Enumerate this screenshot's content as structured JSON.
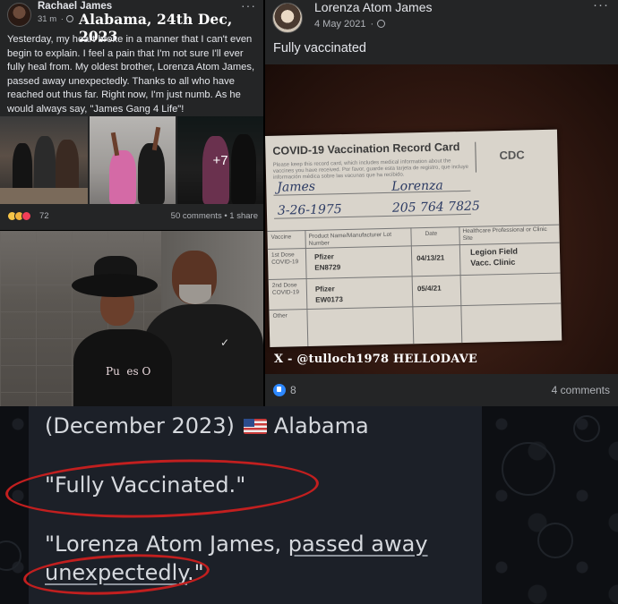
{
  "left_post": {
    "author": "Rachael James",
    "time": "31 m",
    "overlay_title": "Alabama, 24th Dec, 2023",
    "body": "Yesterday, my heart broke in a manner that I can't even begin to explain. I feel a pain that I'm not sure I'll ever fully heal from. My oldest brother, Lorenza Atom James, passed away unexpectedly. Thanks to all who have reached out thus far. Right now, I'm just numb. As he would always say, \"James Gang 4 Life\"!",
    "more_photos": "+7",
    "reactions_count": "72",
    "comments_shares": "50 comments • 1 share",
    "more_icon": "ellipsis-icon"
  },
  "left_photo": {
    "shirt_text": "Pu  es O"
  },
  "right_post": {
    "author": "Lorenza Atom James",
    "date": "4 May 2021",
    "text": "Fully vaccinated",
    "card": {
      "title": "COVID-19 Vaccination Record Card",
      "logo": "CDC",
      "fine_print": "Please keep this record card, which includes medical information about the vaccines you have received. Por favor, guarde esta tarjeta de registro, que incluye información médica sobre las vacunas que ha recibido.",
      "last_name": "James",
      "first_name": "Lorenza",
      "dob": "3-26-1975",
      "patient_number": "205 764 7825",
      "col_vaccine": "Vaccine",
      "col_product": "Product Name/Manufacturer Lot Number",
      "col_date": "Date",
      "col_site": "Healthcare Professional or Clinic Site",
      "row1_label": "1st Dose COVID-19",
      "row2_label": "2nd Dose COVID-19",
      "row3_label": "Other",
      "dose1_product": "Pfizer",
      "dose1_lot": "EN8729",
      "dose1_date": "04/13/21",
      "dose2_product": "Pfizer",
      "dose2_lot": "EW0173",
      "dose2_date": "05/4/21",
      "clinic_line1": "Legion Field",
      "clinic_line2": "Vacc. Clinic"
    },
    "watermark": "X - @tulloch1978 HELLODAVE",
    "likes": "8",
    "comments": "4 comments"
  },
  "bottom": {
    "line1_date": "(December 2023)",
    "line1_place": "Alabama",
    "quote1": "\"Fully Vaccinated.\"",
    "quote2_prefix": "\"Lorenza Atom James, ",
    "quote2_link1": "passed away",
    "quote2_link2": "unexpectedly",
    "quote2_suffix": ".\""
  },
  "colors": {
    "fb_card": "#242526",
    "fb_text": "#e4e6eb",
    "fb_muted": "#b0b3b8",
    "like_blue": "#2d88ff",
    "annotation_red": "#c21f1f",
    "chat_bubble": "#1c2028"
  }
}
